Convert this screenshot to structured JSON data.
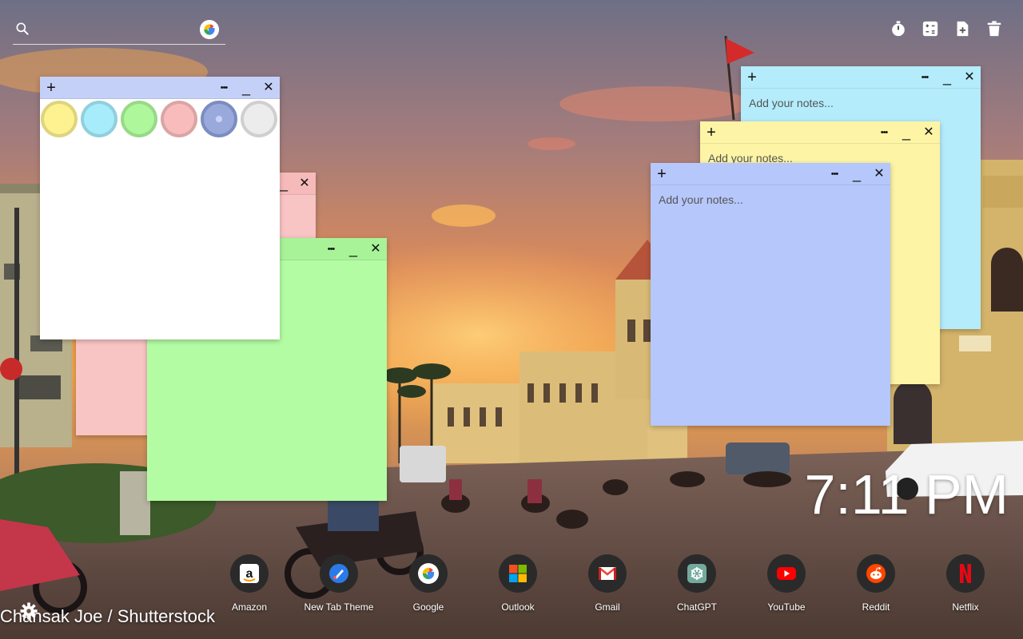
{
  "search": {
    "placeholder": "",
    "value": "",
    "engine_icon": "google-icon"
  },
  "toolbar": {
    "tools": [
      "timer-icon",
      "calculator-icon",
      "add-note-icon",
      "trash-icon"
    ]
  },
  "notes": {
    "white": {
      "palette": [
        {
          "name": "yellow",
          "color": "#fdf28f"
        },
        {
          "name": "cyan",
          "color": "#a6ecfb"
        },
        {
          "name": "green",
          "color": "#aef79b"
        },
        {
          "name": "pink",
          "color": "#f9bcbc"
        },
        {
          "name": "blue",
          "color": "#9aa9dc"
        },
        {
          "name": "gray",
          "color": "#ececec"
        }
      ]
    },
    "cyan": {
      "placeholder": "Add your notes..."
    },
    "yellow": {
      "placeholder": "Add your notes..."
    },
    "blue": {
      "placeholder": "Add your notes..."
    }
  },
  "header_buttons": {
    "add": "+",
    "more": "•••",
    "minimize": "_",
    "close": "✕"
  },
  "clock": {
    "time": "7:11 PM"
  },
  "shortcuts": [
    {
      "label": "Amazon",
      "icon": "amazon-icon"
    },
    {
      "label": "New Tab Theme",
      "icon": "new-tab-theme-icon"
    },
    {
      "label": "Google",
      "icon": "google-icon"
    },
    {
      "label": "Outlook",
      "icon": "outlook-icon"
    },
    {
      "label": "Gmail",
      "icon": "gmail-icon"
    },
    {
      "label": "ChatGPT",
      "icon": "chatgpt-icon"
    },
    {
      "label": "YouTube",
      "icon": "youtube-icon"
    },
    {
      "label": "Reddit",
      "icon": "reddit-icon"
    },
    {
      "label": "Netflix",
      "icon": "netflix-icon"
    }
  ],
  "footer": {
    "credit": "Chansak Joe / Shutterstock"
  }
}
